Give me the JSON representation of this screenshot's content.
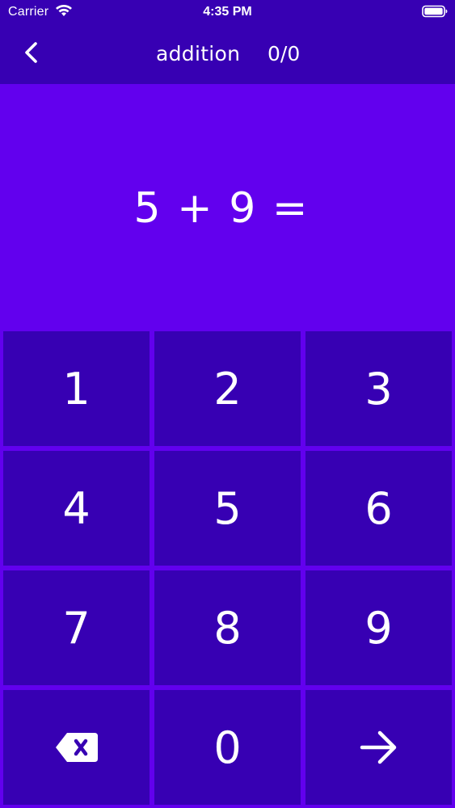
{
  "status_bar": {
    "carrier": "Carrier",
    "time": "4:35 PM",
    "icons": [
      "wifi-icon",
      "battery-icon"
    ]
  },
  "nav": {
    "back_icon": "chevron-left-icon",
    "title": "addition",
    "score": "0/0"
  },
  "question": {
    "text": "5 + 9 ="
  },
  "keypad": {
    "keys": [
      {
        "label": "1"
      },
      {
        "label": "2"
      },
      {
        "label": "3"
      },
      {
        "label": "4"
      },
      {
        "label": "5"
      },
      {
        "label": "6"
      },
      {
        "label": "7"
      },
      {
        "label": "8"
      },
      {
        "label": "9"
      },
      {
        "icon": "backspace-icon"
      },
      {
        "label": "0"
      },
      {
        "icon": "arrow-right-icon"
      }
    ]
  },
  "colors": {
    "top_bar": "#3700b3",
    "question_bg": "#6200ee",
    "key_bg": "#3700b3",
    "text": "#ffffff"
  }
}
